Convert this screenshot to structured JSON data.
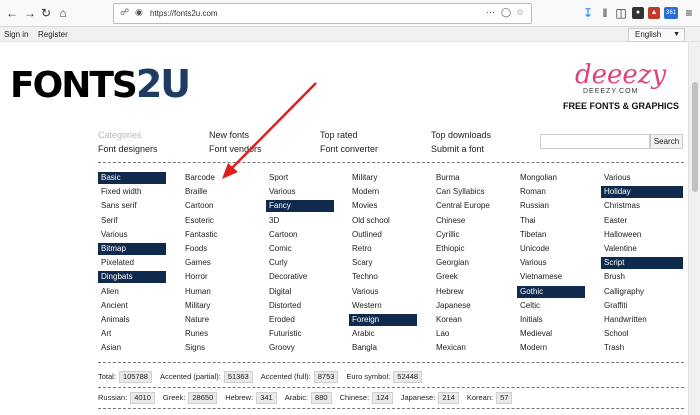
{
  "browser": {
    "url": "https://fonts2u.com",
    "extension_badge": "361"
  },
  "site_header": {
    "sign_in": "Sign in",
    "register": "Register",
    "language": "English"
  },
  "logo": {
    "text_main": "FONTS",
    "text_accent": "2U"
  },
  "ad": {
    "brand": "deeezy",
    "site": "DEEEZY.COM",
    "tagline": "FREE FONTS & GRAPHICS"
  },
  "nav": {
    "categories": "Categories",
    "font_designers": "Font designers",
    "new_fonts": "New fonts",
    "font_vendors": "Font vendors",
    "top_rated": "Top rated",
    "font_converter": "Font converter",
    "top_downloads": "Top downloads",
    "submit_font": "Submit a font",
    "search_button": "Search"
  },
  "category_columns": [
    {
      "items": [
        "Basic",
        "Fixed width",
        "Sans serif",
        "Serif",
        "Various",
        "Bitmap",
        "Pixelated",
        "Dingbats",
        "Alien",
        "Ancient",
        "Animals",
        "Art",
        "Asian"
      ],
      "selected": [
        0,
        5,
        7
      ]
    },
    {
      "items": [
        "Barcode",
        "Braille",
        "Cartoon",
        "Esoteric",
        "Fantastic",
        "Foods",
        "Games",
        "Horror",
        "Human",
        "Military",
        "Nature",
        "Runes",
        "Signs"
      ],
      "selected": []
    },
    {
      "items": [
        "Sport",
        "Various",
        "Fancy",
        "3D",
        "Cartoon",
        "Comic",
        "Curly",
        "Decorative",
        "Digital",
        "Distorted",
        "Eroded",
        "Futuristic",
        "Groovy"
      ],
      "selected": [
        2
      ]
    },
    {
      "items": [
        "Military",
        "Modern",
        "Movies",
        "Old school",
        "Outlined",
        "Retro",
        "Scary",
        "Techno",
        "Various",
        "Western",
        "Foreign",
        "Arabic",
        "Bangla"
      ],
      "selected": [
        10
      ]
    },
    {
      "items": [
        "Burma",
        "Can Syllabics",
        "Central Europe",
        "Chinese",
        "Cyrillic",
        "Ethiopic",
        "Georgian",
        "Greek",
        "Hebrew",
        "Japanese",
        "Korean",
        "Lao",
        "Mexican"
      ],
      "selected": []
    },
    {
      "items": [
        "Mongolian",
        "Roman",
        "Russian",
        "Thai",
        "Tibetan",
        "Unicode",
        "Various",
        "Vietnamese",
        "Gothic",
        "Celtic",
        "Initials",
        "Medieval",
        "Modern"
      ],
      "selected": [
        8
      ]
    },
    {
      "items": [
        "Various",
        "Holiday",
        "Christmas",
        "Easter",
        "Halloween",
        "Valentine",
        "Script",
        "Brush",
        "Calligraphy",
        "Graffiti",
        "Handwritten",
        "School",
        "Trash"
      ],
      "selected": [
        1,
        6
      ]
    }
  ],
  "stats_row1": [
    {
      "label": "Total:",
      "value": "105788"
    },
    {
      "label": "Accented (partial):",
      "value": "51363"
    },
    {
      "label": "Accented (full):",
      "value": "8753"
    },
    {
      "label": "Euro symbol:",
      "value": "52448"
    }
  ],
  "stats_row2": [
    {
      "label": "Russian:",
      "value": "4010"
    },
    {
      "label": "Greek:",
      "value": "28650"
    },
    {
      "label": "Hebrew:",
      "value": "341"
    },
    {
      "label": "Arabic:",
      "value": "880"
    },
    {
      "label": "Chinese:",
      "value": "124"
    },
    {
      "label": "Japanese:",
      "value": "214"
    },
    {
      "label": "Korean:",
      "value": "57"
    }
  ],
  "colors": {
    "selected_bg": "#0f2a4d",
    "arrow": "#e02020",
    "logo_accent": "#1d3b63",
    "ad_brand": "#e0427a"
  }
}
